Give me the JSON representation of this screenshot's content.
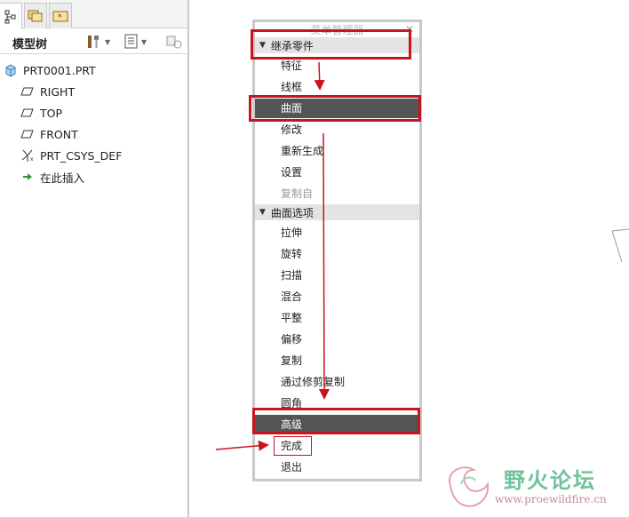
{
  "model_tree": {
    "title": "模型树",
    "items": [
      {
        "label": "PRT0001.PRT",
        "icon": "part-icon"
      },
      {
        "label": "RIGHT",
        "icon": "datum-plane-icon"
      },
      {
        "label": "TOP",
        "icon": "datum-plane-icon"
      },
      {
        "label": "FRONT",
        "icon": "datum-plane-icon"
      },
      {
        "label": "PRT_CSYS_DEF",
        "icon": "coordinate-system-icon"
      },
      {
        "label": "在此插入",
        "icon": "insert-arrow-icon"
      }
    ]
  },
  "menu_manager": {
    "title": "菜单管理器",
    "sections": [
      {
        "header": "继承零件",
        "items": [
          {
            "label": "特征",
            "state": "normal"
          },
          {
            "label": "线框",
            "state": "normal"
          },
          {
            "label": "曲面",
            "state": "selected"
          },
          {
            "label": "修改",
            "state": "normal"
          },
          {
            "label": "重新生成",
            "state": "normal"
          },
          {
            "label": "设置",
            "state": "normal"
          },
          {
            "label": "复制自",
            "state": "disabled"
          }
        ]
      },
      {
        "header": "曲面选项",
        "items": [
          {
            "label": "拉伸",
            "state": "normal"
          },
          {
            "label": "旋转",
            "state": "normal"
          },
          {
            "label": "扫描",
            "state": "normal"
          },
          {
            "label": "混合",
            "state": "normal"
          },
          {
            "label": "平整",
            "state": "normal"
          },
          {
            "label": "偏移",
            "state": "normal"
          },
          {
            "label": "复制",
            "state": "normal"
          },
          {
            "label": "通过修剪复制",
            "state": "normal"
          },
          {
            "label": "圆角",
            "state": "normal"
          },
          {
            "label": "高级",
            "state": "selected"
          },
          {
            "label": "完成",
            "state": "normal"
          },
          {
            "label": "退出",
            "state": "normal"
          }
        ]
      }
    ]
  },
  "watermark": {
    "text": "野火论坛",
    "url": "www.proewildfire.cn"
  },
  "colors": {
    "highlight": "#c8141e",
    "selected_bg": "#555555",
    "watermark_green": "#6fc29a"
  }
}
